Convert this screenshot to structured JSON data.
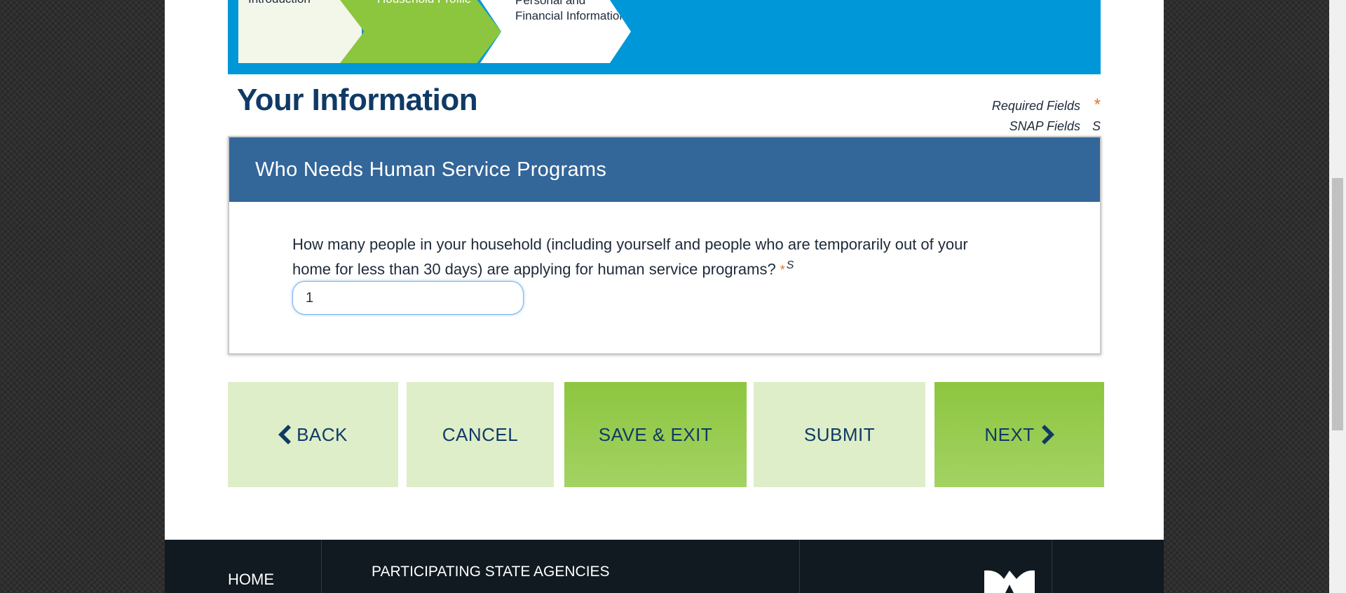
{
  "stepper": {
    "steps": [
      {
        "label": "Introduction"
      },
      {
        "label": "Household Profile"
      },
      {
        "label": "Personal and Financial Information"
      }
    ]
  },
  "page": {
    "title": "Your Information"
  },
  "legend": {
    "required_label": "Required Fields",
    "required_mark": "*",
    "snap_label": "SNAP Fields",
    "snap_mark": "S"
  },
  "section": {
    "header": "Who Needs Human Service Programs",
    "question": "How many people in your household (including yourself and people who are temporarily out of your home for less than 30 days) are applying for human service programs?",
    "required_mark": "*",
    "snap_mark": "S",
    "household_count_value": "1"
  },
  "buttons": {
    "back": "BACK",
    "cancel": "CANCEL",
    "save_exit": "SAVE & EXIT",
    "submit": "SUBMIT",
    "next": "NEXT"
  },
  "footer": {
    "home": "HOME",
    "agencies": "PARTICIPATING STATE AGENCIES"
  },
  "colors": {
    "stepper_bg": "#0097d8",
    "active_step": "#8cc63f",
    "card_header": "#336699",
    "title": "#0f3a66",
    "required": "#e8742a",
    "button_light": "#deeec8",
    "button_green": "#8dc63f"
  }
}
